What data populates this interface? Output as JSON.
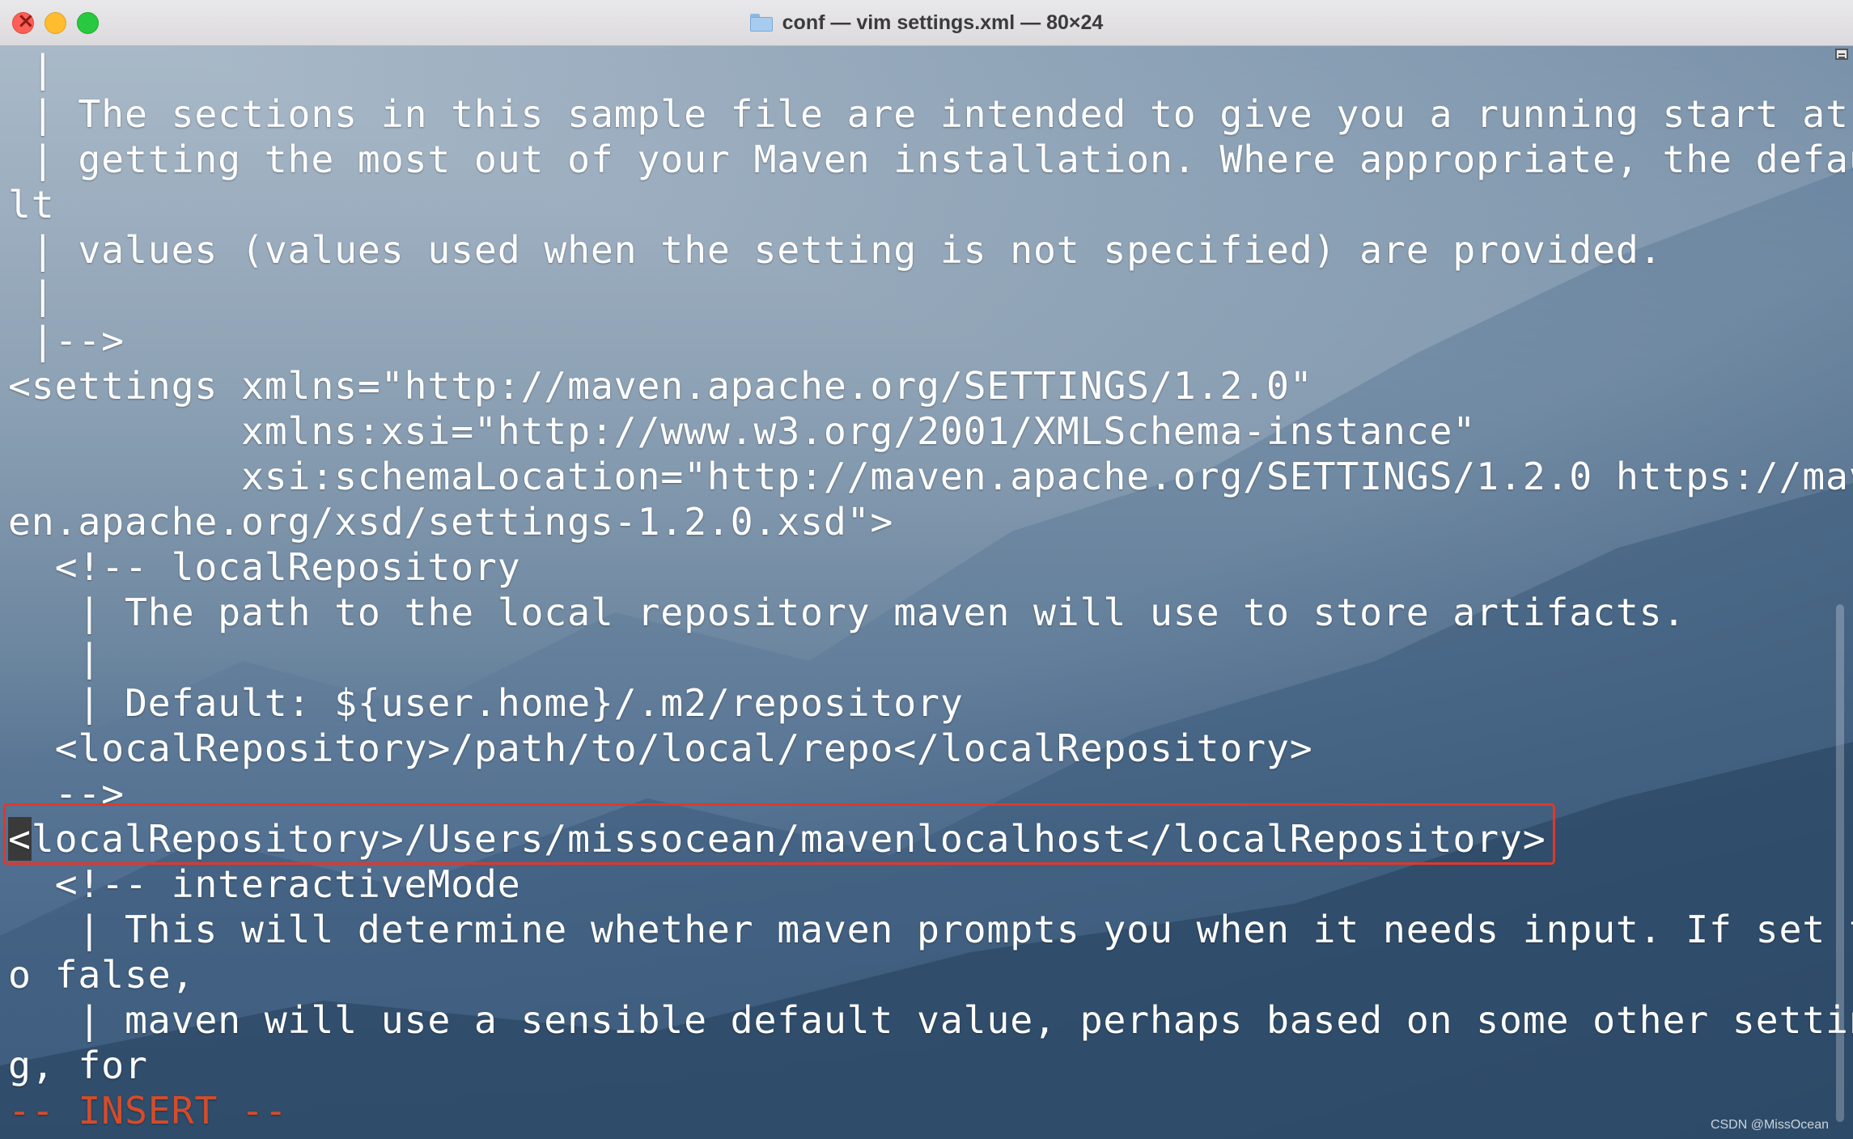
{
  "window": {
    "title": "conf — vim settings.xml — 80×24"
  },
  "editor": {
    "lines": [
      " |",
      " | The sections in this sample file are intended to give you a running start at",
      " | getting the most out of your Maven installation. Where appropriate, the defau",
      "lt",
      " | values (values used when the setting is not specified) are provided.",
      " |",
      " |-->",
      "<settings xmlns=\"http://maven.apache.org/SETTINGS/1.2.0\"",
      "          xmlns:xsi=\"http://www.w3.org/2001/XMLSchema-instance\"",
      "          xsi:schemaLocation=\"http://maven.apache.org/SETTINGS/1.2.0 https://mav",
      "en.apache.org/xsd/settings-1.2.0.xsd\">",
      "  <!-- localRepository",
      "   | The path to the local repository maven will use to store artifacts.",
      "   |",
      "   | Default: ${user.home}/.m2/repository",
      "  <localRepository>/path/to/local/repo</localRepository>",
      "  -->"
    ],
    "highlighted_line_cursor_char": "<",
    "highlighted_line_rest": "localRepository>/Users/missocean/mavenlocalhost</localRepository>",
    "lines_after": [
      "  <!-- interactiveMode",
      "   | This will determine whether maven prompts you when it needs input. If set t",
      "o false,",
      "   | maven will use a sensible default value, perhaps based on some other settin",
      "g, for"
    ],
    "mode_indicator": "-- INSERT --"
  },
  "watermark": "CSDN @MissOcean",
  "colors": {
    "highlight_border": "#e0382a",
    "mode_text": "#d44c2a"
  }
}
